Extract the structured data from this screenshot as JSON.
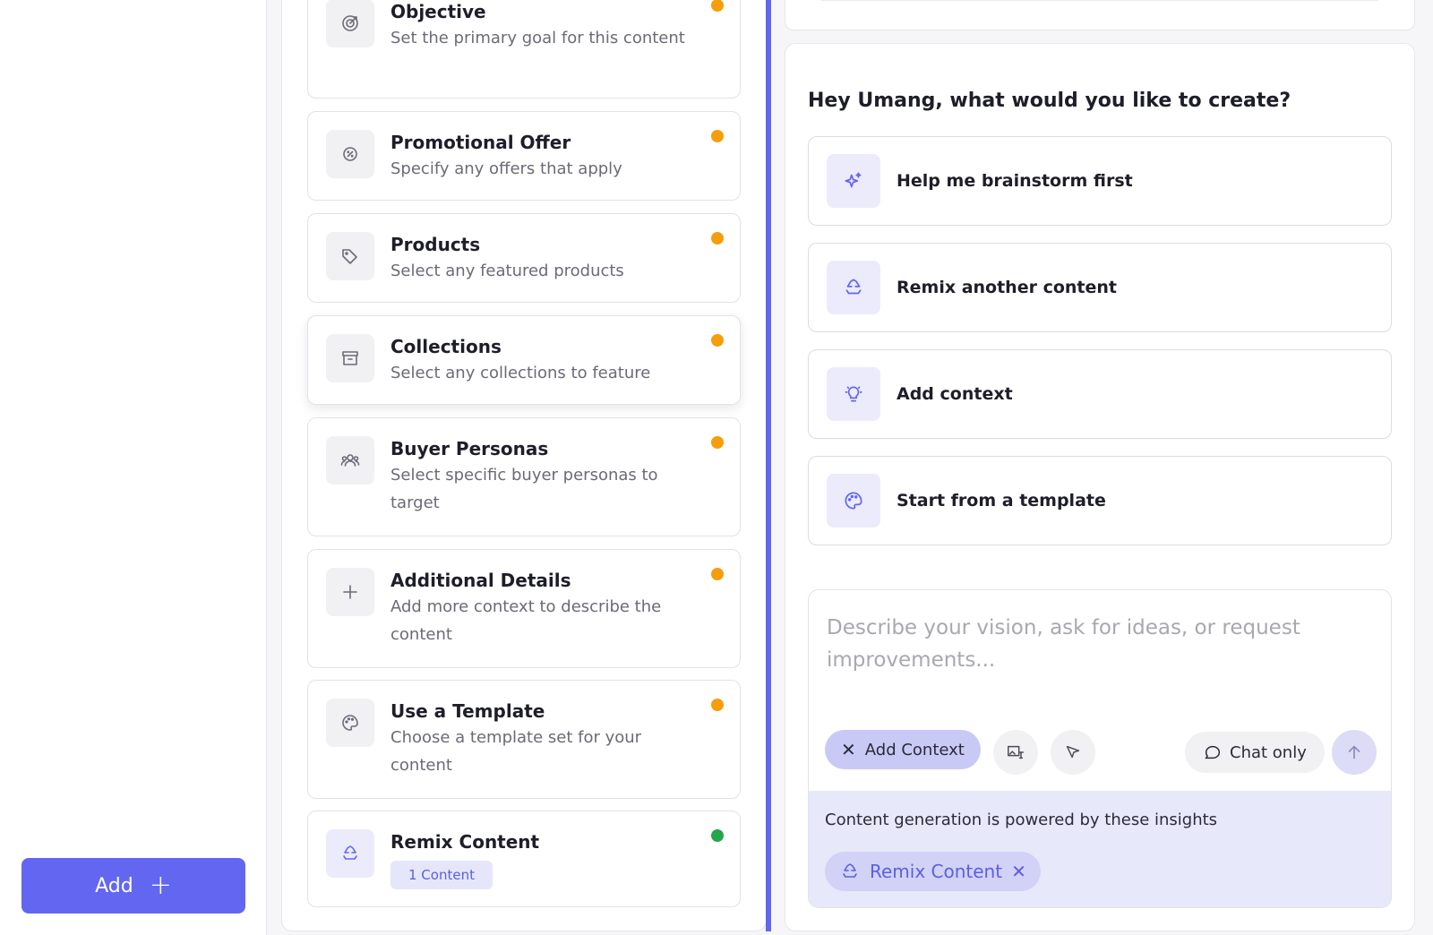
{
  "sidebar": {
    "add_button_label": "Add",
    "add_button_icon": "+"
  },
  "context_cards": [
    {
      "title": "Objective",
      "description": "Set the primary goal for this content",
      "status": "pending",
      "icon": "target-icon"
    },
    {
      "title": "Promotional Offer",
      "description": "Specify any offers that apply",
      "status": "pending",
      "icon": "discount-icon"
    },
    {
      "title": "Products",
      "description": "Select any featured products",
      "status": "pending",
      "icon": "tag-icon"
    },
    {
      "title": "Collections",
      "description": "Select any collections to feature",
      "status": "pending",
      "icon": "archive-icon"
    },
    {
      "title": "Buyer Personas",
      "description": "Select specific buyer personas to target",
      "status": "pending",
      "icon": "users-icon"
    },
    {
      "title": "Additional Details",
      "description": "Add more context to describe the content",
      "status": "pending",
      "icon": "plus-icon"
    },
    {
      "title": "Use a Template",
      "description": "Choose a template set for your content",
      "status": "pending",
      "icon": "palette-icon"
    },
    {
      "title": "Remix Content",
      "chip": "1 Content",
      "status": "done",
      "icon": "recycle-icon"
    }
  ],
  "status_colors": {
    "pending": "#f59e0b",
    "done": "#22a74a"
  },
  "assistant": {
    "greeting": "Hey Umang, what would you like to create?",
    "options": [
      {
        "label": "Help me brainstorm first",
        "icon": "sparkles-icon"
      },
      {
        "label": "Remix another content",
        "icon": "recycle-icon"
      },
      {
        "label": "Add context",
        "icon": "lightbulb-icon"
      },
      {
        "label": "Start from a template",
        "icon": "palette-icon"
      }
    ]
  },
  "composer": {
    "placeholder": "Describe your vision, ask for ideas, or request improvements...",
    "value": "",
    "add_context_label": "Add Context",
    "chat_only_label": "Chat only",
    "insights_text": "Content generation is powered by these insights",
    "insight_tag_label": "Remix Content"
  },
  "accent_color": "#6366f1"
}
